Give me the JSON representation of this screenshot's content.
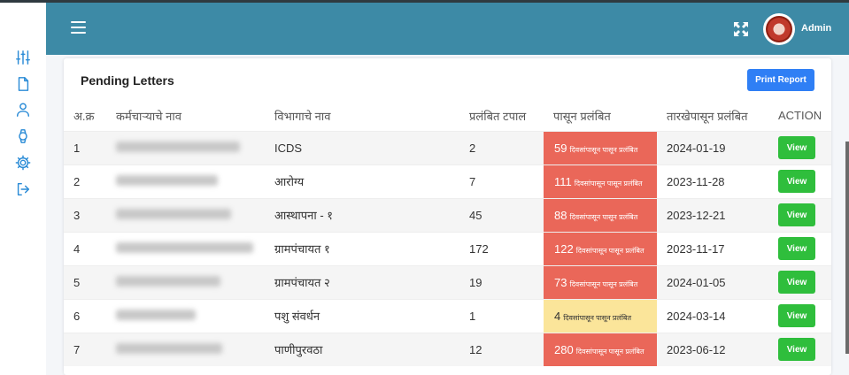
{
  "header": {
    "user_name": "Admin"
  },
  "sidebar": {
    "icons": [
      "sliders-icon",
      "file-icon",
      "user-icon",
      "watch-icon",
      "gear-icon",
      "logout-icon"
    ]
  },
  "card": {
    "title": "Pending Letters",
    "print_label": "Print Report"
  },
  "table": {
    "columns": [
      "अ.क्र",
      "कर्मचाऱ्याचे नाव",
      "विभागाचे नाव",
      "प्रलंबित टपाल",
      "पासून प्रलंबित",
      "तारखेपासून प्रलंबित",
      "ACTION"
    ],
    "view_label": "View",
    "pending_suffix": "दिवसांपासून पासून प्रलंबित",
    "rows": [
      {
        "sr": "1",
        "department": "ICDS",
        "pending": "2",
        "days": "59",
        "status": "red",
        "date": "2024-01-19"
      },
      {
        "sr": "2",
        "department": "आरोग्य",
        "pending": "7",
        "days": "111",
        "status": "red",
        "date": "2023-11-28"
      },
      {
        "sr": "3",
        "department": "आस्थापना - १",
        "pending": "45",
        "days": "88",
        "status": "red",
        "date": "2023-12-21"
      },
      {
        "sr": "4",
        "department": "ग्रामपंचायत १",
        "pending": "172",
        "days": "122",
        "status": "red",
        "date": "2023-11-17"
      },
      {
        "sr": "5",
        "department": "ग्रामपंचायत २",
        "pending": "19",
        "days": "73",
        "status": "red",
        "date": "2024-01-05"
      },
      {
        "sr": "6",
        "department": "पशु संवर्धन",
        "pending": "1",
        "days": "4",
        "status": "yellow",
        "date": "2024-03-14"
      },
      {
        "sr": "7",
        "department": "पाणीपुरवठा",
        "pending": "12",
        "days": "280",
        "status": "red",
        "date": "2023-06-12"
      }
    ]
  },
  "colors": {
    "header": "#3d8aa6",
    "pending_red": "#ea6759",
    "pending_yellow": "#fbe59a",
    "view": "#2fbe3c",
    "print": "#2f7ff5"
  }
}
